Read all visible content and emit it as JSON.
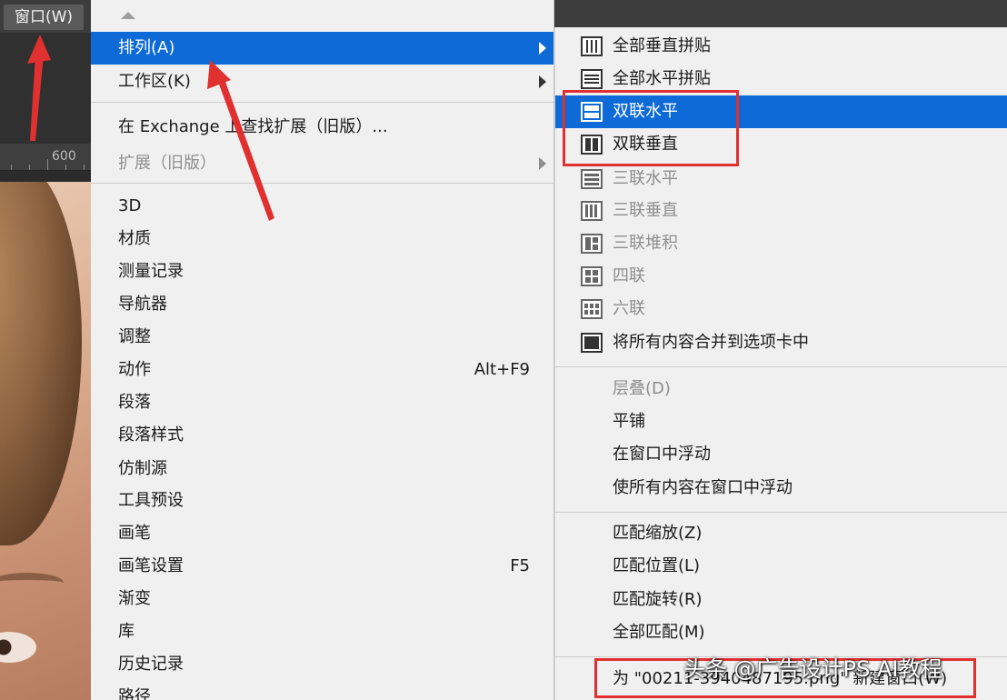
{
  "app": {
    "window_menu_label": "窗口(W)",
    "ruler_value": "600"
  },
  "menu": {
    "items": [
      {
        "label": "排列(A)",
        "shortcut": "",
        "submenu": true,
        "state": "highlighted"
      },
      {
        "label": "工作区(K)",
        "shortcut": "",
        "submenu": true,
        "state": "normal"
      },
      {
        "label": "在 Exchange 上查找扩展（旧版）...",
        "shortcut": "",
        "submenu": false,
        "state": "normal"
      },
      {
        "label": "扩展（旧版）",
        "shortcut": "",
        "submenu": true,
        "state": "disabled"
      },
      {
        "label": "3D",
        "shortcut": "",
        "submenu": false,
        "state": "normal"
      },
      {
        "label": "材质",
        "shortcut": "",
        "submenu": false,
        "state": "normal"
      },
      {
        "label": "测量记录",
        "shortcut": "",
        "submenu": false,
        "state": "normal"
      },
      {
        "label": "导航器",
        "shortcut": "",
        "submenu": false,
        "state": "normal"
      },
      {
        "label": "调整",
        "shortcut": "",
        "submenu": false,
        "state": "normal"
      },
      {
        "label": "动作",
        "shortcut": "Alt+F9",
        "submenu": false,
        "state": "normal"
      },
      {
        "label": "段落",
        "shortcut": "",
        "submenu": false,
        "state": "normal"
      },
      {
        "label": "段落样式",
        "shortcut": "",
        "submenu": false,
        "state": "normal"
      },
      {
        "label": "仿制源",
        "shortcut": "",
        "submenu": false,
        "state": "normal"
      },
      {
        "label": "工具预设",
        "shortcut": "",
        "submenu": false,
        "state": "normal"
      },
      {
        "label": "画笔",
        "shortcut": "",
        "submenu": false,
        "state": "normal"
      },
      {
        "label": "画笔设置",
        "shortcut": "F5",
        "submenu": false,
        "state": "normal"
      },
      {
        "label": "渐变",
        "shortcut": "",
        "submenu": false,
        "state": "normal"
      },
      {
        "label": "库",
        "shortcut": "",
        "submenu": false,
        "state": "normal"
      },
      {
        "label": "历史记录",
        "shortcut": "",
        "submenu": false,
        "state": "normal"
      },
      {
        "label": "路径",
        "shortcut": "",
        "submenu": false,
        "state": "normal"
      }
    ]
  },
  "submenu": {
    "items": [
      {
        "label": "全部垂直拼贴",
        "icon": "tile-all-vertical-icon",
        "state": "normal"
      },
      {
        "label": "全部水平拼贴",
        "icon": "tile-all-horizontal-icon",
        "state": "normal"
      },
      {
        "label": "双联水平",
        "icon": "two-up-horizontal-icon",
        "state": "highlighted"
      },
      {
        "label": "双联垂直",
        "icon": "two-up-vertical-icon",
        "state": "normal"
      },
      {
        "label": "三联水平",
        "icon": "three-up-horizontal-icon",
        "state": "disabled"
      },
      {
        "label": "三联垂直",
        "icon": "three-up-vertical-icon",
        "state": "disabled"
      },
      {
        "label": "三联堆积",
        "icon": "three-up-stacked-icon",
        "state": "disabled"
      },
      {
        "label": "四联",
        "icon": "four-up-icon",
        "state": "disabled"
      },
      {
        "label": "六联",
        "icon": "six-up-icon",
        "state": "disabled"
      },
      {
        "label": "将所有内容合并到选项卡中",
        "icon": "consolidate-tabs-icon",
        "state": "normal"
      },
      {
        "label": "层叠(D)",
        "state": "disabled"
      },
      {
        "label": "平铺",
        "state": "normal"
      },
      {
        "label": "在窗口中浮动",
        "state": "normal"
      },
      {
        "label": "使所有内容在窗口中浮动",
        "state": "normal"
      },
      {
        "label": "匹配缩放(Z)",
        "state": "normal"
      },
      {
        "label": "匹配位置(L)",
        "state": "normal"
      },
      {
        "label": "匹配旋转(R)",
        "state": "normal"
      },
      {
        "label": "全部匹配(M)",
        "state": "normal"
      },
      {
        "label": "为 \"00211-3940487195.png\" 新建窗口(W)",
        "state": "normal"
      }
    ]
  },
  "watermark": "头条 @广告设计PS AI教程",
  "colors": {
    "highlight": "#0d6ad6",
    "annotation_red": "#e03030",
    "menu_bg": "#f0f0f0",
    "disabled_text": "#8e8e8e"
  }
}
